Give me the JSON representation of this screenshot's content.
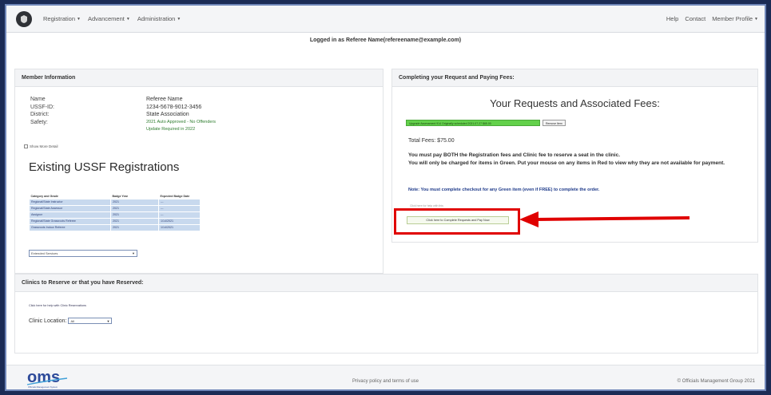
{
  "nav": {
    "items": [
      "Registration",
      "Advancement",
      "Administration"
    ],
    "right_items": [
      "Help",
      "Contact",
      "Member Profile"
    ]
  },
  "logged_in": "Logged in as Referee Name(refereename@example.com)",
  "member": {
    "header": "Member Information",
    "rows": [
      {
        "label": "Name",
        "value": "Referee Name"
      },
      {
        "label": "USSF-ID:",
        "value": "1234-5678-9012-3456"
      },
      {
        "label": "District:",
        "value": "State Association"
      },
      {
        "label": "Safety:",
        "value": "2021 Auto Approved - No Offenders"
      }
    ],
    "safety_extra": "Update Required in 2022",
    "show_more": "Show More Detail",
    "existing_title": "Existing USSF Registrations",
    "table_headers": [
      "Category and Grade",
      "Badge Year",
      "Expected Badge Date"
    ],
    "table_rows": [
      [
        "Regional/State Instructor",
        "2021",
        "---"
      ],
      [
        "Regional/State Assessor",
        "2021",
        "---"
      ],
      [
        "Assignor",
        "2021",
        "---"
      ],
      [
        "Regional/State Grassroots Referee",
        "2021",
        "1/14/2021"
      ],
      [
        "Grassroots Indoor Referee",
        "2021",
        "1/14/2021"
      ]
    ],
    "select_value": "Extended Services"
  },
  "fees": {
    "header": "Completing your Request and Paying Fees:",
    "title": "Your Requests and Associated Fees:",
    "green_item": "Upgrade Assessment 914 Originally scheduled 2021.07.27 $65.00",
    "remove_label": "Remove Item",
    "total": "Total Fees: $75.00",
    "line1": "You must pay BOTH the Registration fees and Clinic fee to reserve a seat in the clinic.",
    "line2": "You will only be charged for items in Green. Put your mouse on any items in Red to view why they are not available for payment.",
    "note": "Note: You must complete checkout for any Green item (even if FREE) to complete the order.",
    "help_link": "Click here for help with this",
    "complete_button": "Click here to Complete Requests and Pay Now",
    "highlight_color": "#e00000"
  },
  "clinics": {
    "header": "Clinics to Reserve or that you have Reserved:",
    "help_link": "Click here for help with Clinic Reservations",
    "location_label": "Clinic Location:",
    "location_value": "All"
  },
  "footer": {
    "logo_text": "oms",
    "logo_sub": "Officials Management System",
    "policy": "Privacy policy and terms of use",
    "copyright": "© Officials Management Group 2021"
  }
}
